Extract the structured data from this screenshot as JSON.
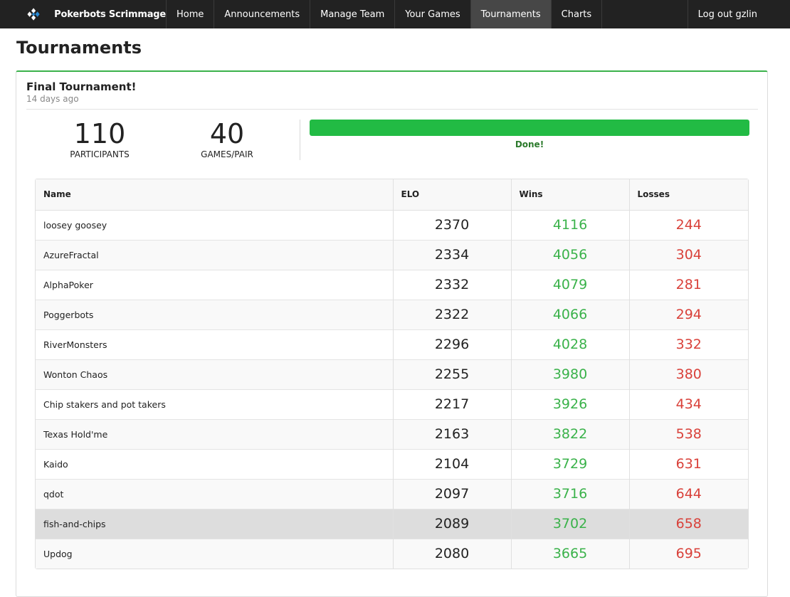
{
  "navbar": {
    "brand": "Pokerbots Scrimmage",
    "logo_icon": "card-suits-logo-icon",
    "items": [
      {
        "label": "Home",
        "active": false
      },
      {
        "label": "Announcements",
        "active": false
      },
      {
        "label": "Manage Team",
        "active": false
      },
      {
        "label": "Your Games",
        "active": false
      },
      {
        "label": "Tournaments",
        "active": true
      },
      {
        "label": "Charts",
        "active": false
      }
    ],
    "logout": "Log out gzlin"
  },
  "page": {
    "title": "Tournaments"
  },
  "tournament": {
    "name": "Final Tournament!",
    "age": "14 days ago",
    "participants": "110",
    "participants_label": "PARTICIPANTS",
    "games_per_pair": "40",
    "games_per_pair_label": "GAMES/PAIR",
    "progress_percent": 100,
    "progress_color": "#22bb44",
    "status": "Done!"
  },
  "table": {
    "columns": [
      "Name",
      "ELO",
      "Wins",
      "Losses"
    ],
    "rows": [
      {
        "name": "loosey goosey",
        "elo": "2370",
        "wins": "4116",
        "losses": "244"
      },
      {
        "name": "AzureFractal",
        "elo": "2334",
        "wins": "4056",
        "losses": "304"
      },
      {
        "name": "AlphaPoker",
        "elo": "2332",
        "wins": "4079",
        "losses": "281"
      },
      {
        "name": "Poggerbots",
        "elo": "2322",
        "wins": "4066",
        "losses": "294"
      },
      {
        "name": "RiverMonsters",
        "elo": "2296",
        "wins": "4028",
        "losses": "332"
      },
      {
        "name": "Wonton Chaos",
        "elo": "2255",
        "wins": "3980",
        "losses": "380"
      },
      {
        "name": "Chip stakers and pot takers",
        "elo": "2217",
        "wins": "3926",
        "losses": "434"
      },
      {
        "name": "Texas Hold'me",
        "elo": "2163",
        "wins": "3822",
        "losses": "538"
      },
      {
        "name": "Kaido",
        "elo": "2104",
        "wins": "3729",
        "losses": "631"
      },
      {
        "name": "qdot",
        "elo": "2097",
        "wins": "3716",
        "losses": "644"
      },
      {
        "name": "fish-and-chips",
        "elo": "2089",
        "wins": "3702",
        "losses": "658",
        "highlight": true
      },
      {
        "name": "Updog",
        "elo": "2080",
        "wins": "3665",
        "losses": "695"
      }
    ],
    "colors": {
      "wins": "#3ab24a",
      "losses": "#d9413a"
    }
  }
}
